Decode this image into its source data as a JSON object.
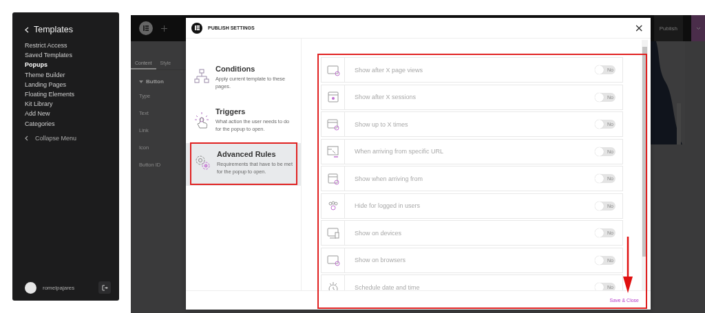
{
  "sidebar": {
    "title": "Templates",
    "items": [
      {
        "label": "Restrict Access",
        "selected": false
      },
      {
        "label": "Saved Templates",
        "selected": false
      },
      {
        "label": "Popups",
        "selected": true
      },
      {
        "label": "Theme Builder",
        "selected": false
      },
      {
        "label": "Landing Pages",
        "selected": false
      },
      {
        "label": "Floating Elements",
        "selected": false
      },
      {
        "label": "Kit Library",
        "selected": false
      },
      {
        "label": "Add New",
        "selected": false
      },
      {
        "label": "Categories",
        "selected": false
      }
    ],
    "collapse_label": "Collapse Menu",
    "user": "romelpajares"
  },
  "editor": {
    "publish_label": "Publish",
    "panel_tabs": [
      {
        "label": "Content",
        "selected": true
      },
      {
        "label": "Style",
        "selected": false
      }
    ],
    "section": "Button",
    "fields": [
      "Type",
      "Text",
      "Link",
      "Icon",
      "Button ID"
    ]
  },
  "modal": {
    "title": "PUBLISH SETTINGS",
    "close_label": "×",
    "nav": [
      {
        "title": "Conditions",
        "description": "Apply current template to these pages.",
        "selected": false
      },
      {
        "title": "Triggers",
        "description": "What action the user needs to do for the popup to open.",
        "selected": false
      },
      {
        "title": "Advanced Rules",
        "description": "Requirements that have to be met for the popup to open.",
        "selected": true
      }
    ],
    "rules": [
      {
        "label": "Show after X page views",
        "on": false,
        "toggle_label": "No"
      },
      {
        "label": "Show after X sessions",
        "on": false,
        "toggle_label": "No"
      },
      {
        "label": "Show up to X times",
        "on": false,
        "toggle_label": "No"
      },
      {
        "label": "When arriving from specific URL",
        "on": false,
        "toggle_label": "No"
      },
      {
        "label": "Show when arriving from",
        "on": false,
        "toggle_label": "No"
      },
      {
        "label": "Hide for logged in users",
        "on": false,
        "toggle_label": "No"
      },
      {
        "label": "Show on devices",
        "on": false,
        "toggle_label": "No"
      },
      {
        "label": "Show on browsers",
        "on": false,
        "toggle_label": "No"
      },
      {
        "label": "Schedule date and time",
        "on": false,
        "toggle_label": "No"
      }
    ],
    "save_label": "Save & Close"
  }
}
